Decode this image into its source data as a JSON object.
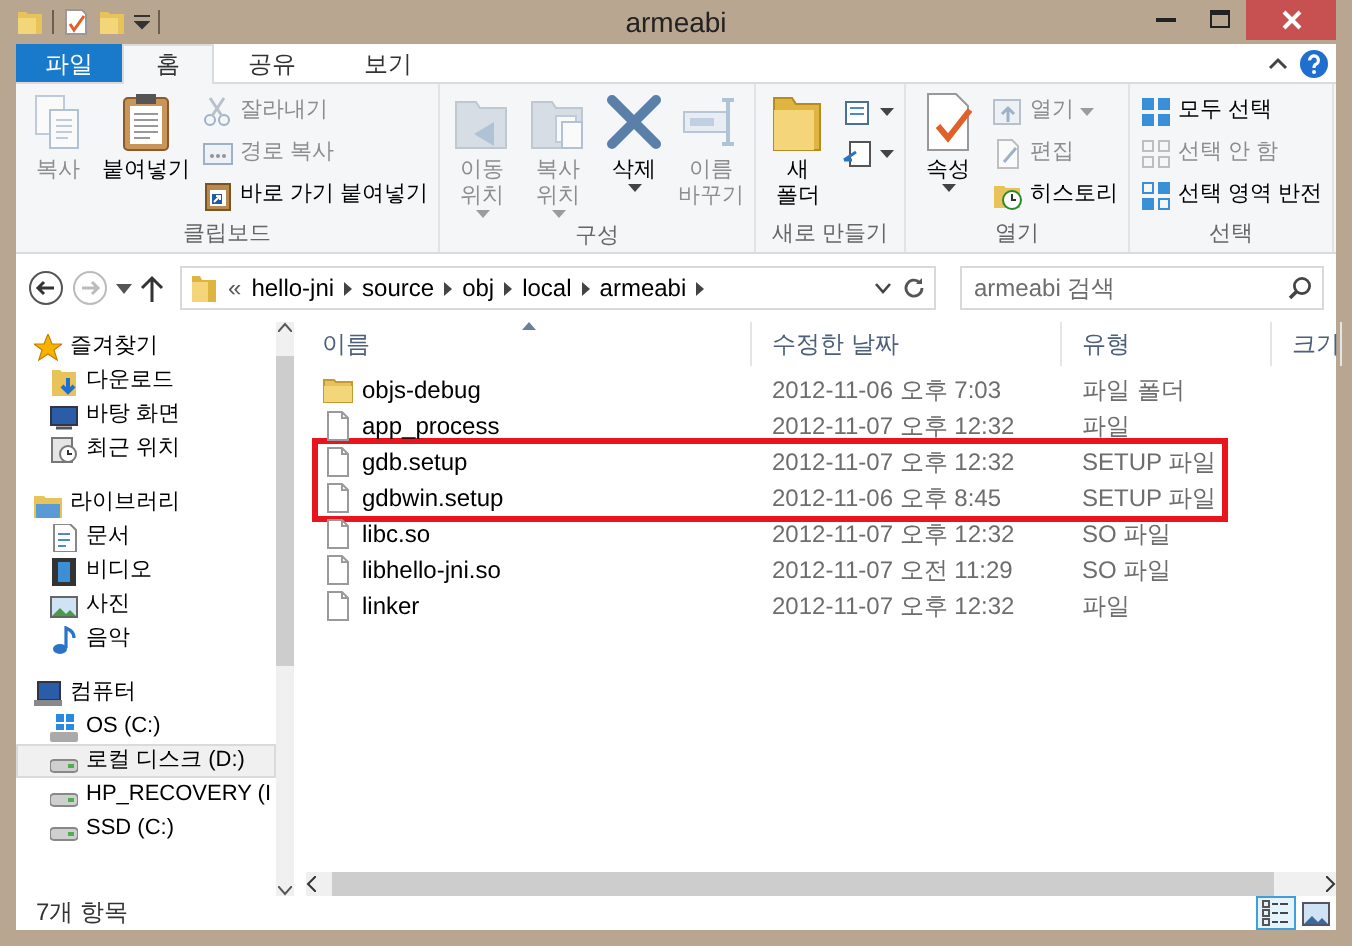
{
  "window": {
    "title": "armeabi"
  },
  "ribbon_tabs": [
    {
      "label": "파일",
      "kind": "file",
      "selected": false
    },
    {
      "label": "홈",
      "kind": "tab",
      "selected": true
    },
    {
      "label": "공유",
      "kind": "tab",
      "selected": false
    },
    {
      "label": "보기",
      "kind": "tab",
      "selected": false
    }
  ],
  "ribbon_groups": [
    {
      "label": "클립보드",
      "items": [
        {
          "kind": "large",
          "lines": [
            "복사"
          ],
          "disabled": true,
          "dropdown": false
        },
        {
          "kind": "large",
          "lines": [
            "붙여넣기"
          ],
          "disabled": false,
          "dropdown": false
        },
        {
          "kind": "stack",
          "items": [
            {
              "label": "잘라내기",
              "disabled": true,
              "dropdown": false
            },
            {
              "label": "경로 복사",
              "disabled": true,
              "dropdown": false
            },
            {
              "label": "바로 가기 붙여넣기",
              "disabled": false,
              "dropdown": false
            }
          ]
        }
      ]
    },
    {
      "label": "구성",
      "items": [
        {
          "kind": "large",
          "lines": [
            "이동",
            "위치"
          ],
          "disabled": true,
          "dropdown": true
        },
        {
          "kind": "large",
          "lines": [
            "복사",
            "위치"
          ],
          "disabled": true,
          "dropdown": true
        },
        {
          "kind": "large",
          "lines": [
            "삭제"
          ],
          "disabled": false,
          "dropdown": true
        },
        {
          "kind": "large",
          "lines": [
            "이름",
            "바꾸기"
          ],
          "disabled": true,
          "dropdown": false
        }
      ]
    },
    {
      "label": "새로 만들기",
      "items": [
        {
          "kind": "large",
          "lines": [
            "새",
            "폴더"
          ],
          "disabled": false,
          "dropdown": false
        },
        {
          "kind": "stack",
          "items": [
            {
              "disabled": false,
              "dropdown": true
            },
            {
              "disabled": false,
              "dropdown": true
            }
          ]
        }
      ]
    },
    {
      "label": "열기",
      "items": [
        {
          "kind": "large",
          "lines": [
            "속성"
          ],
          "disabled": false,
          "dropdown": true
        },
        {
          "kind": "stack",
          "items": [
            {
              "label": "열기",
              "disabled": true,
              "dropdown": true
            },
            {
              "label": "편집",
              "disabled": true,
              "dropdown": false
            },
            {
              "label": "히스토리",
              "disabled": false,
              "dropdown": false
            }
          ]
        }
      ]
    },
    {
      "label": "선택",
      "items": [
        {
          "kind": "stack",
          "items": [
            {
              "label": "모두 선택",
              "disabled": false,
              "dropdown": false
            },
            {
              "label": "선택 안 함",
              "disabled": true,
              "dropdown": false
            },
            {
              "label": "선택 영역 반전",
              "disabled": false,
              "dropdown": false
            }
          ]
        }
      ]
    }
  ],
  "address_bar": {
    "overflow_mark": "«",
    "path": [
      "hello-jni",
      "source",
      "obj",
      "local",
      "armeabi"
    ],
    "forward_disabled": true
  },
  "search": {
    "placeholder": "armeabi 검색"
  },
  "sidebar": {
    "items": [
      {
        "label": "즐겨찾기",
        "selected": false,
        "children": [
          {
            "label": "다운로드",
            "selected": false
          },
          {
            "label": "바탕 화면",
            "selected": false
          },
          {
            "label": "최근 위치",
            "selected": false
          }
        ]
      },
      {
        "label": "라이브러리",
        "selected": false,
        "children": [
          {
            "label": "문서",
            "selected": false
          },
          {
            "label": "비디오",
            "selected": false
          },
          {
            "label": "사진",
            "selected": false
          },
          {
            "label": "음악",
            "selected": false
          }
        ]
      },
      {
        "label": "컴퓨터",
        "selected": false,
        "children": [
          {
            "label": "OS (C:)",
            "selected": false
          },
          {
            "label": "로컬 디스크 (D:)",
            "selected": true
          },
          {
            "label": "HP_RECOVERY (I",
            "selected": false
          },
          {
            "label": "SSD (C:)",
            "selected": false
          }
        ]
      }
    ]
  },
  "file_list": {
    "columns": [
      "이름",
      "수정한 날짜",
      "유형",
      "크기"
    ],
    "rows": [
      {
        "kind": "folder",
        "name": "objs-debug",
        "date": "2012-11-06 오후 7:03",
        "type": "파일 폴더",
        "highlighted": false
      },
      {
        "kind": "file",
        "name": "app_process",
        "date": "2012-11-07 오후 12:32",
        "type": "파일",
        "highlighted": false
      },
      {
        "kind": "file",
        "name": "gdb.setup",
        "date": "2012-11-07 오후 12:32",
        "type": "SETUP 파일",
        "highlighted": true
      },
      {
        "kind": "file",
        "name": "gdbwin.setup",
        "date": "2012-11-06 오후 8:45",
        "type": "SETUP 파일",
        "highlighted": true
      },
      {
        "kind": "file",
        "name": "libc.so",
        "date": "2012-11-07 오후 12:32",
        "type": "SO 파일",
        "highlighted": false
      },
      {
        "kind": "file",
        "name": "libhello-jni.so",
        "date": "2012-11-07 오전 11:29",
        "type": "SO 파일",
        "highlighted": false
      },
      {
        "kind": "file",
        "name": "linker",
        "date": "2012-11-07 오후 12:32",
        "type": "파일",
        "highlighted": false
      }
    ]
  },
  "status_bar": {
    "text": "7개 항목",
    "views": [
      {
        "kind": "details",
        "selected": true
      },
      {
        "kind": "large_icons",
        "selected": false
      }
    ]
  }
}
